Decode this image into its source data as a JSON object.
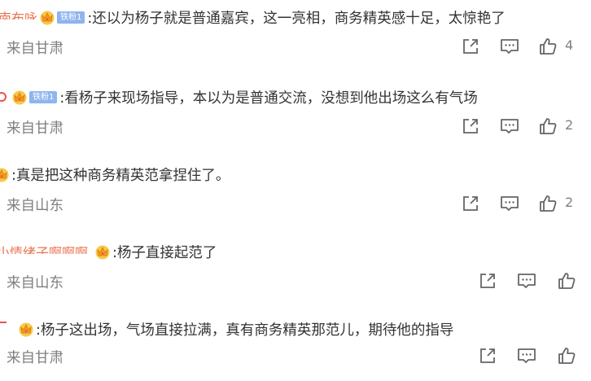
{
  "comments": [
    {
      "username": "南布咏",
      "badge": "铁粉1",
      "text": ":还以为杨子就是普通嘉宾，这一亮相，商务精英感十足，太惊艳了",
      "location": "来自甘肃",
      "likes": "4"
    },
    {
      "badge": "铁粉1",
      "text": ":看杨子来现场指导，本以为是普通交流，没想到他出场这么有气场",
      "location": "来自甘肃",
      "likes": "2"
    },
    {
      "text": ":真是把这种商务精英范拿捏住了。",
      "location": "来自山东",
      "likes": "2"
    },
    {
      "username": "小情绪子啊啊啊",
      "text": ":杨子直接起范了",
      "location": "来自山东"
    },
    {
      "text": ":杨子这出场，气场直接拉满，真有商务精英那范儿，期待他的指导",
      "location": "来自甘肃"
    }
  ],
  "icons": {
    "share": "share-icon",
    "comment": "comment-icon",
    "like": "thumbs-up-icon",
    "crown": "crown-icon"
  },
  "colors": {
    "username": "#eb7350",
    "badge_bg": "#8fb4ee",
    "meta_text": "#808080",
    "body_text": "#333333"
  }
}
